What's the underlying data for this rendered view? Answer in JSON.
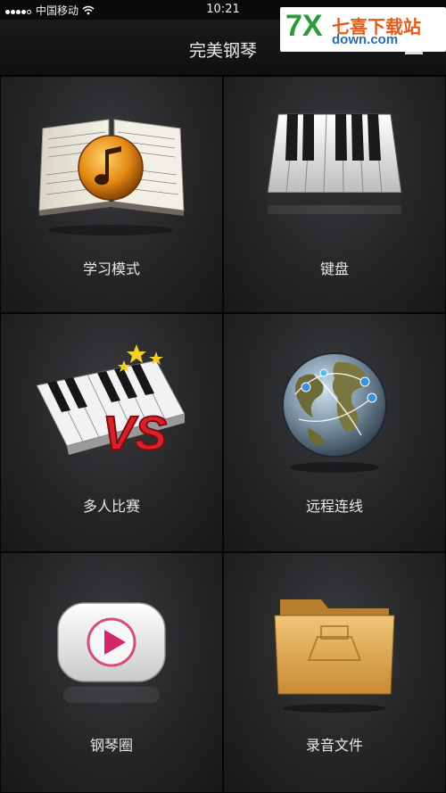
{
  "status_bar": {
    "carrier": "中国移动",
    "time": "10:21"
  },
  "header": {
    "title": "完美钢琴"
  },
  "watermark": {
    "brand_mark": "7X",
    "brand_name": "七喜下载站",
    "url": "down.com"
  },
  "menu": {
    "items": [
      {
        "label": "学习模式",
        "icon": "music-book-icon"
      },
      {
        "label": "键盘",
        "icon": "piano-keyboard-icon"
      },
      {
        "label": "多人比赛",
        "icon": "piano-versus-icon"
      },
      {
        "label": "远程连线",
        "icon": "globe-network-icon"
      },
      {
        "label": "钢琴圈",
        "icon": "play-button-icon"
      },
      {
        "label": "录音文件",
        "icon": "folder-icon"
      }
    ]
  }
}
